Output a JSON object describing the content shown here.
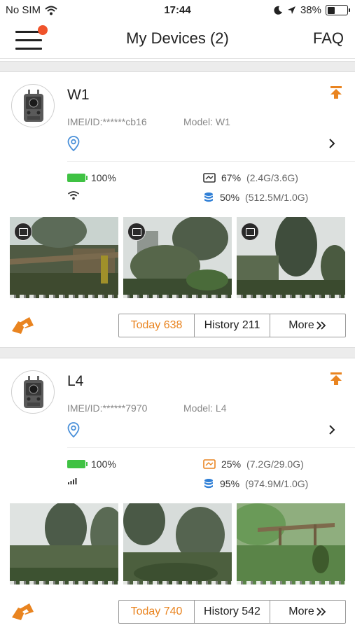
{
  "status_bar": {
    "carrier": "No SIM",
    "time": "17:44",
    "battery": "38%",
    "battery_level": 0.38
  },
  "nav": {
    "title": "My Devices (2)",
    "faq": "FAQ"
  },
  "colors": {
    "accent": "#e98420",
    "badge": "#f0532b",
    "battery_green": "#3fc243",
    "location_blue": "#4a90d9",
    "storage_blue": "#2f7fd6"
  },
  "devices": [
    {
      "name": "W1",
      "imei": "IMEI/ID:******cb16",
      "model": "Model: W1",
      "battery": "100%",
      "signal_icon": "wifi-icon",
      "sd_card": "67%",
      "sd_card_detail": "(2.4G/3.6G)",
      "sd_icon_style": "outline",
      "data": "50%",
      "data_detail": "(512.5M/1.0G)",
      "today": "Today 638",
      "history": "History 211",
      "more": "More"
    },
    {
      "name": "L4",
      "imei": "IMEI/ID:******7970",
      "model": "Model: L4",
      "battery": "100%",
      "signal_icon": "cell-signal-icon",
      "sd_card": "25%",
      "sd_card_detail": "(7.2G/29.0G)",
      "sd_icon_style": "orange",
      "data": "95%",
      "data_detail": "(974.9M/1.0G)",
      "today": "Today 740",
      "history": "History 542",
      "more": "More"
    }
  ]
}
